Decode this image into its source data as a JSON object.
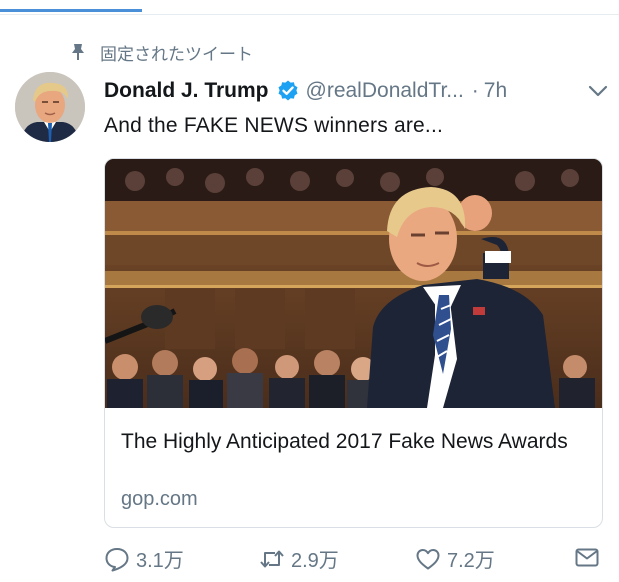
{
  "pinned_label": "固定されたツイート",
  "tweet": {
    "display_name": "Donald J. Trump",
    "handle": "@realDonaldTr...",
    "separator": "·",
    "time": "7h",
    "text": "And the FAKE NEWS winners are..."
  },
  "card": {
    "title": "The Highly Anticipated 2017 Fake News Awards",
    "domain": "gop.com"
  },
  "actions": {
    "reply_count": "3.1万",
    "retweet_count": "2.9万",
    "like_count": "7.2万"
  },
  "icons": {
    "pin": "pin-icon",
    "verified": "verified-badge-icon",
    "caret": "chevron-down-icon",
    "reply": "reply-icon",
    "retweet": "retweet-icon",
    "like": "heart-icon",
    "dm": "envelope-icon"
  },
  "colors": {
    "verified_blue": "#1da1f2",
    "secondary_text": "#657786",
    "primary_text": "#14171a",
    "active_tab": "#4a90d9"
  }
}
